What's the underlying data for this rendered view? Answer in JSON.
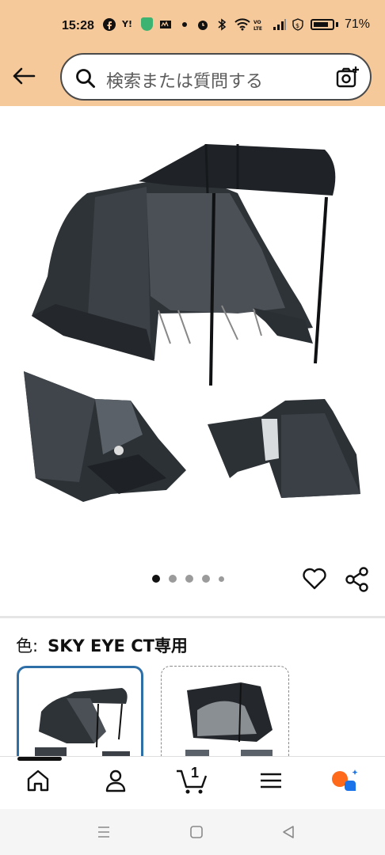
{
  "status_bar": {
    "time": "15:28",
    "battery_pct": "71%",
    "battery_level": 0.71,
    "icons": [
      "facebook-icon",
      "yahoo-icon",
      "shield-icon",
      "app-icon",
      "dot-icon",
      "alarm-icon",
      "bluetooth-icon",
      "wifi-icon",
      "lte-icon",
      "signal-icon",
      "dollar-icon",
      "battery-icon"
    ]
  },
  "header": {
    "search_placeholder": "検索または質問する"
  },
  "gallery": {
    "image_count": 5,
    "active_index": 0
  },
  "product": {
    "color_label": "色:",
    "color_value": "SKY EYE CT専用"
  },
  "cart_count": "1",
  "colors": {
    "header_bg": "#f6c99b",
    "selected_border": "#2f6fa8",
    "assistant_orange": "#ff6a1a",
    "assistant_blue": "#1a73e8"
  }
}
